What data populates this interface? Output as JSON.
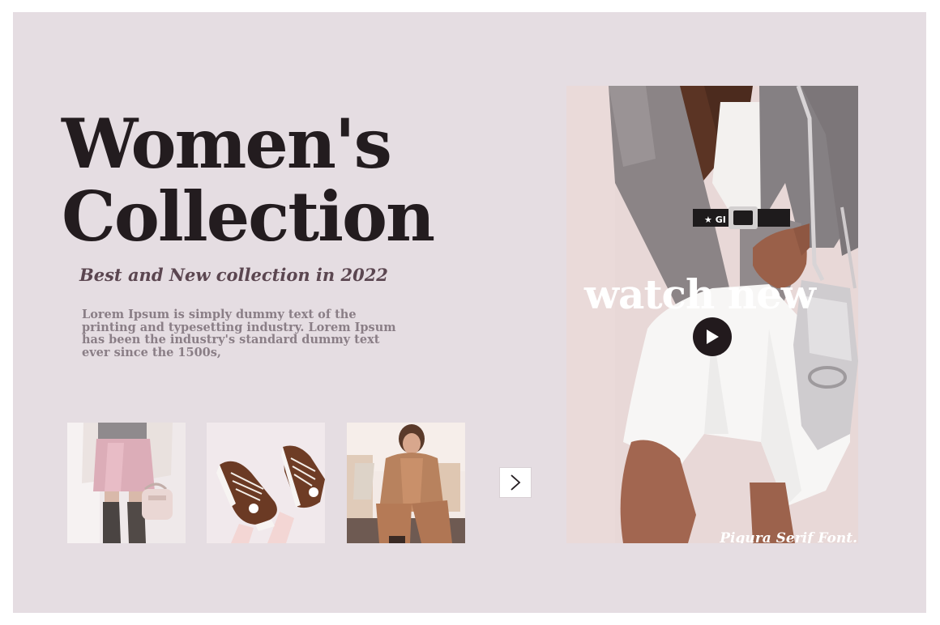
{
  "title": {
    "line1": "Women's",
    "line2": "Collection"
  },
  "subtitle": "Best and New collection in 2022",
  "description": "Lorem Ipsum is simply dummy text of the printing and typesetting industry. Lorem Ipsum has been the industry's standard dummy text ever since the 1500s,",
  "thumbnails": [
    {
      "icon": "photo-pink-skirt-boots-handbag"
    },
    {
      "icon": "photo-brown-sneakers"
    },
    {
      "icon": "photo-camel-coat-seated"
    }
  ],
  "next_button": {
    "icon": "chevron-right-icon"
  },
  "hero": {
    "overlay_text": "watch new",
    "play_icon": "play-icon",
    "font_label": "Pigura Serif Font."
  },
  "colors": {
    "background": "#e5dde2",
    "title": "#231c1f",
    "subtitle": "#5b4650",
    "body_text": "#8a7e86"
  }
}
